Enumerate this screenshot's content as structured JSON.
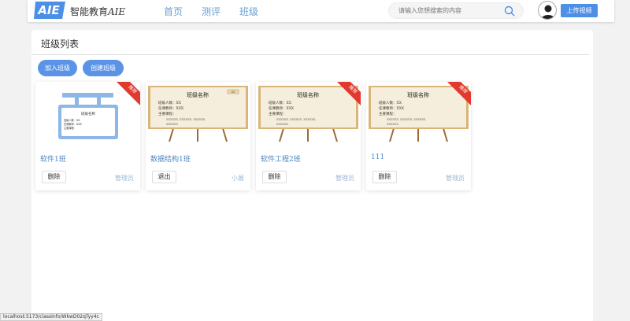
{
  "header": {
    "logo_text": "AIE",
    "brand": "智能教育",
    "brand_suffix": "AIE",
    "nav": [
      "首页",
      "测评",
      "班级"
    ],
    "search_placeholder": "请输入您想搜索的内容",
    "upload_label": "上传视频"
  },
  "main": {
    "title": "班级列表",
    "join_label": "加入班级",
    "create_label": "创建班级"
  },
  "board": {
    "heading": "班级名称",
    "lines": [
      "班级人数：XX",
      "任课教师：XXX",
      "主要课程："
    ],
    "dots": [
      "XXXXXX, XXXXXX, XXXXXX,",
      "XXXXXX"
    ],
    "tag": "XX"
  },
  "cards": [
    {
      "title": "软件1班",
      "action": "删除",
      "role": "管理员",
      "ribbon": "推荐",
      "image": "blue-board"
    },
    {
      "title": "数据结构1班",
      "action": "退出",
      "role": "小展",
      "ribbon": "",
      "image": "easel"
    },
    {
      "title": "软件工程2班",
      "action": "删除",
      "role": "管理员",
      "ribbon": "推荐",
      "image": "easel"
    },
    {
      "title": "111",
      "action": "删除",
      "role": "管理员",
      "ribbon": "推荐",
      "image": "easel"
    }
  ],
  "status_url": "localhost:5173/classInfo/WkwD02qTyy4c",
  "colors": {
    "accent": "#4d8fe6",
    "link": "#4c86c6",
    "ribbon": "#e03a2f",
    "board": "#f6eedc",
    "frame": "#d9b57a"
  }
}
